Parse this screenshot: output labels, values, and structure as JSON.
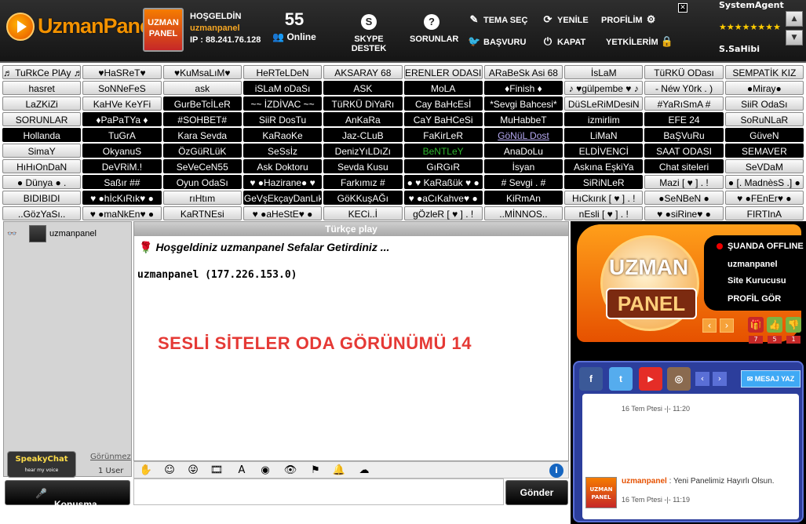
{
  "header": {
    "logo_text": "UzmanPanel",
    "badge_line1": "UZMAN",
    "badge_line2": "PANEL",
    "welcome_label": "HOŞGELDİN",
    "username": "uzmanpanel",
    "ip_label": "IP : 88.241.76.128",
    "online_count": "55",
    "online_label": "Online",
    "skype_label": "SKYPE DESTEK",
    "sorunlar_label": "SORUNLAR",
    "tema_label": "TEMA SEÇ",
    "basvuru_label": "BAŞVURU",
    "yenile_label": "YENİLE",
    "kapat_label": "KAPAT",
    "profilim_label": "PROFİLİM",
    "yetkilerim_label": "YETKİLERİM",
    "system_agent": "SystemAgent",
    "stars": "★★★★★★★★",
    "site_sahibi": "S.SaHibi"
  },
  "rooms": [
    {
      "label": "♬ TuRkCe PlAy ♬",
      "style": "l"
    },
    {
      "label": "♥HaSReT♥",
      "style": "l"
    },
    {
      "label": "♥KuMsaLıM♥",
      "style": "l"
    },
    {
      "label": "HeRTeLDeN",
      "style": "l"
    },
    {
      "label": "AKSARAY 68",
      "style": "l"
    },
    {
      "label": "ERENLER ODASI",
      "style": "l"
    },
    {
      "label": "ARaBeSk Asi 68",
      "style": "l"
    },
    {
      "label": "İsLaM",
      "style": "l"
    },
    {
      "label": "TüRKÜ ODası",
      "style": "l"
    },
    {
      "label": "SEMPATİK KIZ",
      "style": "l"
    },
    {
      "label": "hasret",
      "style": "l"
    },
    {
      "label": "SoNNeFeS",
      "style": "l"
    },
    {
      "label": "ask",
      "style": "l"
    },
    {
      "label": "iSLaM oDaSı",
      "style": "d"
    },
    {
      "label": "ASK",
      "style": "d"
    },
    {
      "label": "MoLA",
      "style": "d"
    },
    {
      "label": "♦Finish ♦",
      "style": "d"
    },
    {
      "label": "♪ ♥gülpembe ♥ ♪",
      "style": "l"
    },
    {
      "label": "- Néw Y0rk . )",
      "style": "l"
    },
    {
      "label": "●Miray●",
      "style": "l"
    },
    {
      "label": "LaZKiZi",
      "style": "l"
    },
    {
      "label": "KaHVe KeYFi",
      "style": "l"
    },
    {
      "label": "GurBeTcİLeR",
      "style": "d"
    },
    {
      "label": "~~ İZDİVAC ~~",
      "style": "d"
    },
    {
      "label": "TüRKÜ DiYaRı",
      "style": "d"
    },
    {
      "label": "Cay BaHcEsİ",
      "style": "d"
    },
    {
      "label": "*Sevgi Bahcesi*",
      "style": "d"
    },
    {
      "label": "DüSLeRiMDesiN",
      "style": "l"
    },
    {
      "label": "#YaRıSmA #",
      "style": "l"
    },
    {
      "label": "SiiR OdaSı",
      "style": "l"
    },
    {
      "label": "SORUNLAR",
      "style": "l"
    },
    {
      "label": "♦PaPaTYa ♦",
      "style": "d"
    },
    {
      "label": "#SOHBET#",
      "style": "d"
    },
    {
      "label": "SiiR DosTu",
      "style": "d"
    },
    {
      "label": "AnKaRa",
      "style": "d"
    },
    {
      "label": "CaY BaHCeSi",
      "style": "d"
    },
    {
      "label": "MuHabbeT",
      "style": "d"
    },
    {
      "label": "izmirlim",
      "style": "d"
    },
    {
      "label": "EFE 24",
      "style": "d"
    },
    {
      "label": "SoRuNLaR",
      "style": "l"
    },
    {
      "label": "Hollanda",
      "style": "d"
    },
    {
      "label": "TuGrA",
      "style": "d"
    },
    {
      "label": "Kara Sevda",
      "style": "d"
    },
    {
      "label": "KaRaoKe",
      "style": "d"
    },
    {
      "label": "Jaz-CLuB",
      "style": "d"
    },
    {
      "label": "FaKirLeR",
      "style": "d"
    },
    {
      "label": "GöNüL Dost",
      "style": "d b"
    },
    {
      "label": "LiMaN",
      "style": "d"
    },
    {
      "label": "BaŞVuRu",
      "style": "d"
    },
    {
      "label": "GüveN",
      "style": "d"
    },
    {
      "label": "SimaY",
      "style": "l"
    },
    {
      "label": "OkyanuS",
      "style": "d"
    },
    {
      "label": "ÖzGüRLüK",
      "style": "d"
    },
    {
      "label": "SeSsİz",
      "style": "d"
    },
    {
      "label": "DenizYıLDıZı",
      "style": "d"
    },
    {
      "label": "BeNTLeY",
      "style": "d g"
    },
    {
      "label": "AnaDoLu",
      "style": "d"
    },
    {
      "label": "ELDİVENCİ",
      "style": "d"
    },
    {
      "label": "SAAT ODASI",
      "style": "d"
    },
    {
      "label": "SEMAVER",
      "style": "d"
    },
    {
      "label": "HıHıOnDaN",
      "style": "l"
    },
    {
      "label": "DeVRiM.!",
      "style": "d"
    },
    {
      "label": "SeVeCeN55",
      "style": "d"
    },
    {
      "label": "Ask Doktoru",
      "style": "d"
    },
    {
      "label": "Sevda Kusu",
      "style": "d"
    },
    {
      "label": "GıRGıR",
      "style": "d"
    },
    {
      "label": "İsyan",
      "style": "d"
    },
    {
      "label": "Askına EşkiYa",
      "style": "d"
    },
    {
      "label": "Chat siteleri",
      "style": "d"
    },
    {
      "label": "SeVDaM",
      "style": "l"
    },
    {
      "label": "● Dünya ● .",
      "style": "l"
    },
    {
      "label": "Saßır ##",
      "style": "d"
    },
    {
      "label": "Oyun OdaSı",
      "style": "d"
    },
    {
      "label": "♥ ●Hazirane● ♥",
      "style": "d"
    },
    {
      "label": "Farkımız #",
      "style": "d"
    },
    {
      "label": "● ♥ KaRaßük ♥ ●",
      "style": "d"
    },
    {
      "label": "# Sevgi . #",
      "style": "d"
    },
    {
      "label": "SiRiNLeR",
      "style": "d"
    },
    {
      "label": "Mazi [ ♥ ] . !",
      "style": "l"
    },
    {
      "label": "● [. MadnèsS .] ●",
      "style": "l"
    },
    {
      "label": "BIDIBIDI",
      "style": "l"
    },
    {
      "label": "♥ ●hİcKıRık♥ ●",
      "style": "d"
    },
    {
      "label": "rıHtım",
      "style": "l"
    },
    {
      "label": "GeVşEkçayDanLık",
      "style": "d"
    },
    {
      "label": "GöKKuşAĞı",
      "style": "d"
    },
    {
      "label": "♥ ●aCıKahve♥ ●",
      "style": "d"
    },
    {
      "label": "KiRmAn",
      "style": "d"
    },
    {
      "label": "HıCkırık [ ♥ ] . !",
      "style": "l"
    },
    {
      "label": "●SeNBeN ●",
      "style": "l"
    },
    {
      "label": "♥ ●FEnEr♥ ●",
      "style": "l"
    },
    {
      "label": "..GözYaSı..",
      "style": "l"
    },
    {
      "label": "♥ ●maNkEn♥ ●",
      "style": "l"
    },
    {
      "label": "KaRTNEsi",
      "style": "l"
    },
    {
      "label": "♥ ●aHeStE♥ ●",
      "style": "l"
    },
    {
      "label": "KECi..İ",
      "style": "l"
    },
    {
      "label": "gÖzleR [ ♥ ] . !",
      "style": "l"
    },
    {
      "label": "..MİNNOS..",
      "style": "l"
    },
    {
      "label": "nEsli [ ♥ ] . !",
      "style": "l"
    },
    {
      "label": "♥ ●siRine♥ ●",
      "style": "l"
    },
    {
      "label": "FIRTInA",
      "style": "l"
    }
  ],
  "leftpanel": {
    "user": "uzmanpanel",
    "speakchat_title": "SpeakyChat",
    "speakchat_sub": "hear my voice",
    "gorunmez": "Görünmez",
    "user_count": "1 User",
    "talk_label": "Konusma"
  },
  "chat": {
    "room_title": "Türkçe play",
    "welcome": "Hoşgeldiniz uzmanpanel Sefalar Getirdiniz ...",
    "ip_line": "uzmanpanel (177.226.153.0)",
    "promo": "SESLİ SİTELER ODA GÖRÜNÜMÜ 14",
    "send_label": "Gönder",
    "input_value": ""
  },
  "rightpanel": {
    "brand_top": "UZMAN",
    "brand_bottom": "PANEL",
    "status": "ŞUANDA OFFLINE",
    "admin": "uzmanpanel",
    "role": "Site Kurucusu",
    "profile": "PROFİL GÖR",
    "gift_count": "7",
    "like_count": "5",
    "dislike_count": "1",
    "mesaj_yaz": "MESAJ YAZ",
    "feed": [
      {
        "time": "16 Tem Ptesi -|- 11:20"
      },
      {
        "user": "uzmanpanel",
        "text": ": Yeni Panelimiz Hayırlı Olsun.",
        "time": "16 Tem Ptesi -|- 11:19"
      }
    ]
  },
  "colors": {
    "accent": "#f39200",
    "promo": "#e53935",
    "social_bg": "#2c3e9c"
  }
}
